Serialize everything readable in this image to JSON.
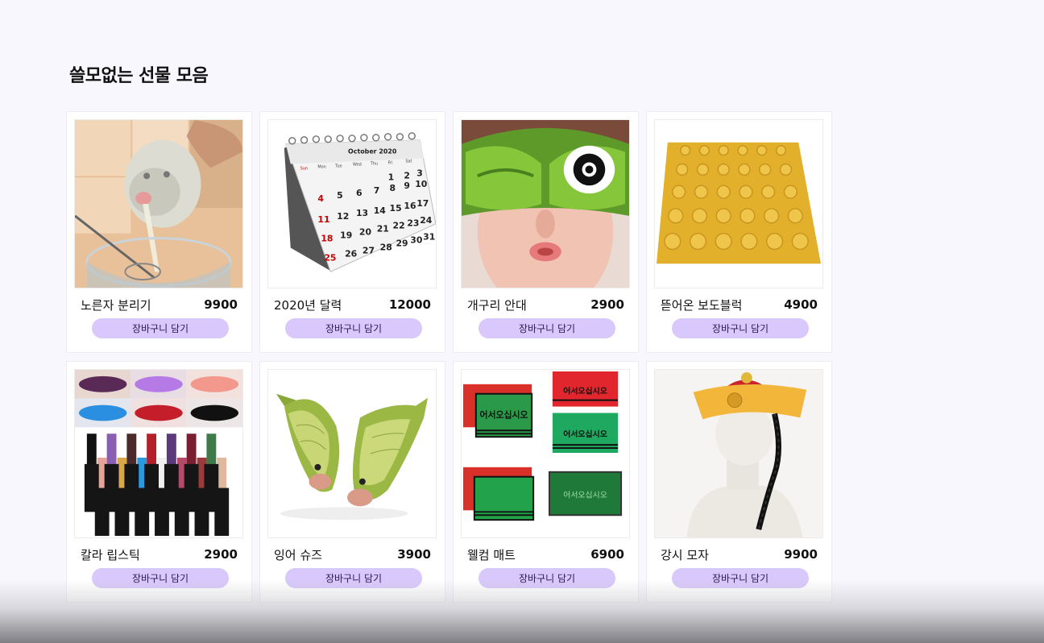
{
  "page": {
    "title": "쓸모없는 선물 모음"
  },
  "products": [
    {
      "name": "노른자 분리기",
      "price": "9900",
      "button": "장바구니 담기",
      "image": "egg-separator-image"
    },
    {
      "name": "2020년 달력",
      "price": "12000",
      "button": "장바구니 담기",
      "image": "calendar-image",
      "image_text": {
        "month": "October 2020",
        "days": [
          "Sun",
          "Mon",
          "Tue",
          "Wed",
          "Thu",
          "Fri",
          "Sat"
        ]
      }
    },
    {
      "name": "개구리 안대",
      "price": "2900",
      "button": "장바구니 담기",
      "image": "frog-eye-mask-image"
    },
    {
      "name": "뜯어온 보도블럭",
      "price": "4900",
      "button": "장바구니 담기",
      "image": "tactile-paving-block-image"
    },
    {
      "name": "칼라 립스틱",
      "price": "2900",
      "button": "장바구니 담기",
      "image": "color-lipstick-image"
    },
    {
      "name": "잉어 슈즈",
      "price": "3900",
      "button": "장바구니 담기",
      "image": "fish-shoes-image"
    },
    {
      "name": "웰컴 매트",
      "price": "6900",
      "button": "장바구니 담기",
      "image": "welcome-mat-image",
      "image_text": "어서오십시오"
    },
    {
      "name": "강시 모자",
      "price": "9900",
      "button": "장바구니 담기",
      "image": "jiangshi-hat-image"
    }
  ],
  "colors": {
    "background": "#f8f7fd",
    "card": "#ffffff",
    "button": "#d8c8fb"
  }
}
